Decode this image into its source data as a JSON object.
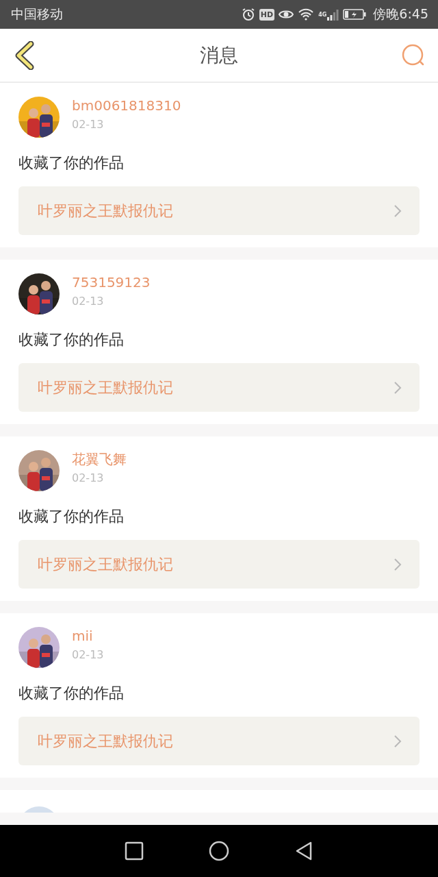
{
  "status_bar": {
    "carrier": "中国移动",
    "hd_badge": "HD",
    "network": "4G",
    "time": "傍晚6:45"
  },
  "header": {
    "title": "消息"
  },
  "messages": [
    {
      "user": "bm0061818310",
      "date": "02-13",
      "action": "收藏了你的作品",
      "work": "叶罗丽之王默报仇记"
    },
    {
      "user": "753159123",
      "date": "02-13",
      "action": "收藏了你的作品",
      "work": "叶罗丽之王默报仇记"
    },
    {
      "user": "花翼飞舞",
      "date": "02-13",
      "action": "收藏了你的作品",
      "work": "叶罗丽之王默报仇记"
    },
    {
      "user": "mii",
      "date": "02-13",
      "action": "收藏了你的作品",
      "work": "叶罗丽之王默报仇记"
    }
  ]
}
